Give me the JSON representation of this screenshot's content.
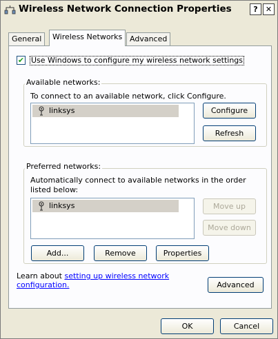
{
  "window": {
    "title": "Wireless Network Connection Properties",
    "help_label": "?",
    "close_label": "✕"
  },
  "tabs": [
    {
      "label": "General",
      "active": false
    },
    {
      "label": "Wireless Networks",
      "active": true
    },
    {
      "label": "Advanced",
      "active": false
    }
  ],
  "use_windows_checkbox": {
    "label": "Use Windows to configure my wireless network settings",
    "checked": true,
    "check_glyph": "✔"
  },
  "available_networks": {
    "legend": "Available networks:",
    "description": "To connect to an available network, click Configure.",
    "items": [
      "linksys"
    ],
    "configure_label": "Configure",
    "refresh_label": "Refresh"
  },
  "preferred_networks": {
    "legend": "Preferred networks:",
    "description": "Automatically connect to available networks in the order listed below:",
    "items": [
      "linksys"
    ],
    "move_up_label": "Move up",
    "move_down_label": "Move down",
    "add_label": "Add...",
    "remove_label": "Remove",
    "properties_label": "Properties"
  },
  "learn_about": {
    "prefix": "Learn about ",
    "link": "setting up wireless network configuration."
  },
  "advanced_button_label": "Advanced",
  "footer": {
    "ok_label": "OK",
    "cancel_label": "Cancel"
  },
  "icons": {
    "title": "network-connection-icon",
    "network": "wireless-antenna-icon"
  }
}
